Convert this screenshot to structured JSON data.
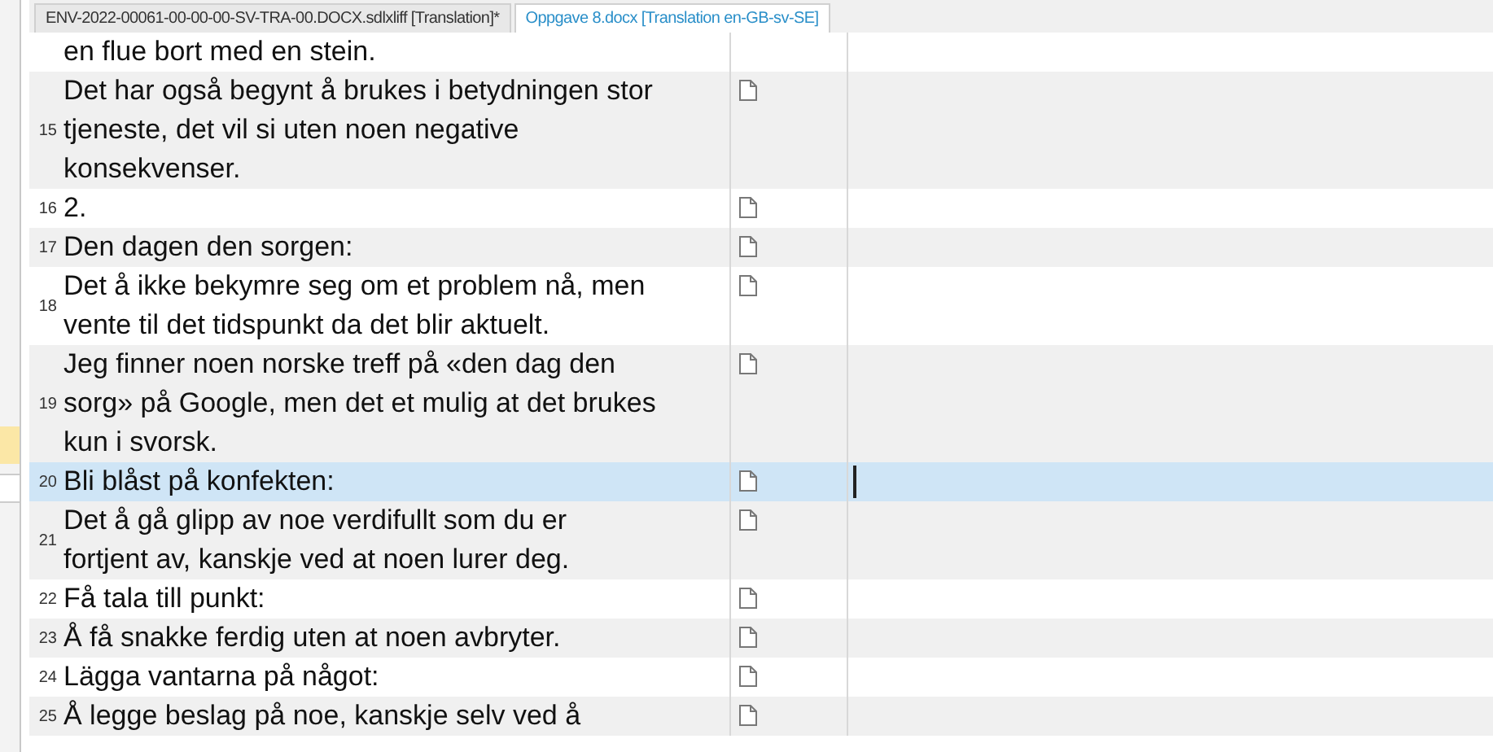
{
  "tabs": [
    {
      "label": "ENV-2022-00061-00-00-00-SV-TRA-00.DOCX.sdlxliff [Translation]*",
      "selected": false
    },
    {
      "label": "Oppgave 8.docx [Translation en-GB-sv-SE]",
      "selected": true
    }
  ],
  "segments": [
    {
      "lines": [
        "en flue bort med en stein."
      ],
      "selected": false
    },
    {
      "number": "15",
      "lines": [
        "Det har også begynt å brukes i betydningen stor",
        "tjeneste, det vil si uten noen negative",
        "konsekvenser."
      ],
      "selected": false
    },
    {
      "number": "16",
      "lines": [
        "2."
      ],
      "selected": false
    },
    {
      "number": "17",
      "lines": [
        "Den dagen den sorgen:"
      ],
      "selected": false
    },
    {
      "number": "18",
      "lines": [
        "Det å ikke bekymre seg om et problem nå, men",
        "vente til det tidspunkt da det blir aktuelt."
      ],
      "selected": false
    },
    {
      "number": "19",
      "lines": [
        "Jeg finner noen norske treff på «den dag den",
        "sorg» på Google, men det et mulig at det brukes",
        "kun i svorsk."
      ],
      "selected": false
    },
    {
      "number": "20",
      "lines": [
        "Bli blåst på konfekten:"
      ],
      "selected": true
    },
    {
      "number": "21",
      "lines": [
        "Det å gå glipp av noe verdifullt som du er",
        "fortjent av, kanskje ved at noen lurer deg."
      ],
      "selected": false
    },
    {
      "number": "22",
      "lines": [
        "Få tala till punkt:"
      ],
      "selected": false
    },
    {
      "number": "23",
      "lines": [
        "Å få snakke ferdig uten at noen avbryter."
      ],
      "selected": false
    },
    {
      "number": "24",
      "lines": [
        "Lägga vantarna på något:"
      ],
      "selected": false
    },
    {
      "number": "25",
      "lines": [
        "Å legge beslag på noe, kanskje selv ved å"
      ],
      "selected": false
    }
  ]
}
